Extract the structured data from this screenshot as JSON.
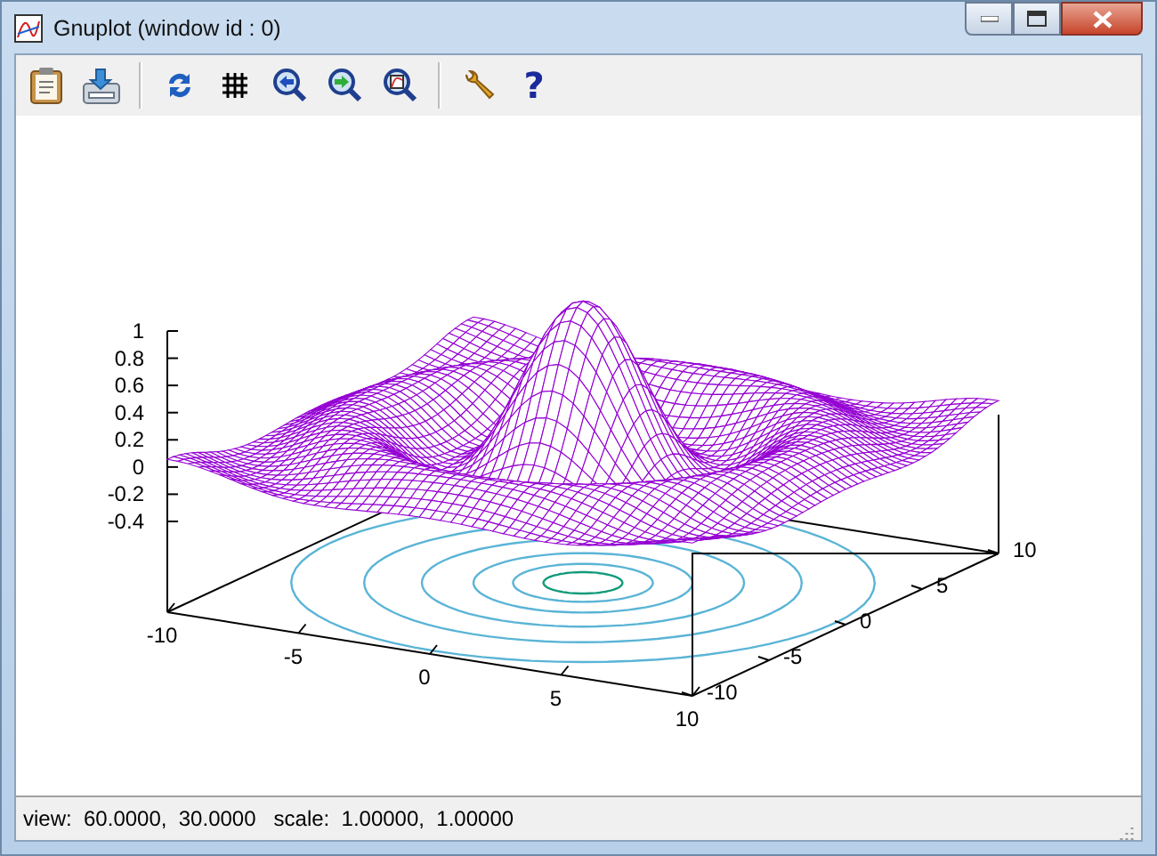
{
  "window": {
    "title": "Gnuplot (window id : 0)"
  },
  "toolbar": [
    {
      "kind": "clipboard"
    },
    {
      "kind": "print"
    },
    {
      "kind": "separator"
    },
    {
      "kind": "replot"
    },
    {
      "kind": "grid"
    },
    {
      "kind": "zoom-prev"
    },
    {
      "kind": "zoom-next"
    },
    {
      "kind": "unzoom"
    },
    {
      "kind": "separator"
    },
    {
      "kind": "options"
    },
    {
      "kind": "help",
      "label": "?"
    }
  ],
  "plot": {
    "z_ticks": [
      "1",
      "0.8",
      "0.6",
      "0.4",
      "0.2",
      "0",
      "-0.2",
      "-0.4"
    ],
    "x_ticks": [
      "-10",
      "-5",
      "0",
      "5",
      "10"
    ],
    "y_ticks": [
      "-10",
      "-5",
      "0",
      "5",
      "10"
    ]
  },
  "status_bar": {
    "text": "view:  60.0000,  30.0000   scale:  1.00000,  1.00000"
  }
}
